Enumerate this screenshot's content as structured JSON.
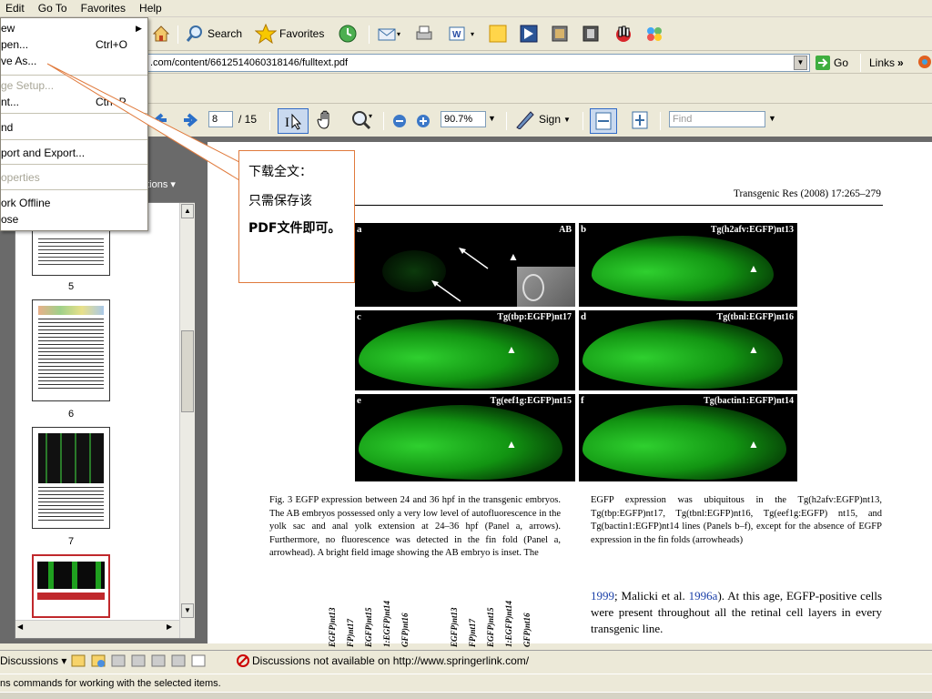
{
  "menubar": {
    "items": [
      "Edit",
      "Go To",
      "Favorites",
      "Help"
    ]
  },
  "ie_toolbar": {
    "search_label": "Search",
    "favorites_label": "Favorites"
  },
  "address": {
    "value": ".com/content/6612514060318146/fulltext.pdf",
    "go_label": "Go",
    "links_label": "Links",
    "more": "»"
  },
  "file_menu": {
    "items": [
      {
        "label": "ew",
        "shortcut": "",
        "disabled": false,
        "submenu": true
      },
      {
        "label": "pen...",
        "shortcut": "Ctrl+O",
        "disabled": false
      },
      {
        "label": "ve As...",
        "shortcut": "",
        "disabled": false
      },
      {
        "label": "ge Setup...",
        "shortcut": "",
        "disabled": true
      },
      {
        "label": "nt...",
        "shortcut": "Ctrl+P",
        "disabled": false
      },
      {
        "label": "nd",
        "shortcut": "",
        "disabled": false
      },
      {
        "label": "port and Export...",
        "shortcut": "",
        "disabled": false
      },
      {
        "label": "operties",
        "shortcut": "",
        "disabled": true
      },
      {
        "label": "ork Offline",
        "shortcut": "",
        "disabled": false
      },
      {
        "label": "ose",
        "shortcut": "",
        "disabled": false
      }
    ]
  },
  "pdf_toolbar": {
    "page_value": "8",
    "page_total": "/ 15",
    "zoom_value": "90.7%",
    "sign_label": "Sign",
    "find_placeholder": "Find"
  },
  "sidebar": {
    "options_label": "ptions",
    "thumb_numbers": [
      "5",
      "6",
      "7"
    ]
  },
  "callout": {
    "lines": [
      "下载全文：",
      "只需保存该",
      "PDF文件即可。"
    ]
  },
  "doc": {
    "header": "Transgenic Res (2008) 17:265–279",
    "panels": [
      {
        "letter": "a",
        "title": "AB"
      },
      {
        "letter": "b",
        "title": "Tg(h2afv:EGFP)nt13"
      },
      {
        "letter": "c",
        "title": "Tg(tbp:EGFP)nt17"
      },
      {
        "letter": "d",
        "title": "Tg(tbnl:EGFP)nt16"
      },
      {
        "letter": "e",
        "title": "Tg(eef1g:EGFP)nt15"
      },
      {
        "letter": "f",
        "title": "Tg(bactin1:EGFP)nt14"
      }
    ],
    "caption_left": "Fig. 3 EGFP expression between 24 and 36 hpf in the transgenic embryos. The AB embryos possessed only a very low level of autofluorescence in the yolk sac and anal yolk extension at 24–36 hpf (Panel a, arrows). Furthermore, no fluorescence was detected in the fin fold (Panel a, arrowhead). A bright field image showing the AB embryo is inset. The",
    "caption_right": "EGFP expression was ubiquitous in the Tg(h2afv:EGFP)nt13, Tg(tbp:EGFP)nt17, Tg(tbnl:EGFP)nt16, Tg(eef1g:EGFP) nt15, and Tg(bactin1:EGFP)nt14 lines (Panels b–f), except for the absence of EGFP expression in the fin folds (arrowheads)",
    "body_right_1": "1999",
    "body_right_2": "; Malicki et al. ",
    "body_right_3": "1996a",
    "body_right_4": "). At this age, EGFP-positive cells were present throughout all the retinal cell layers in every transgenic line.",
    "rotated_labels": [
      "EGFP)nt13",
      "FP)nt17",
      "EGFP)nt15",
      "1:EGFP)nt14",
      "GFP)nt16",
      "EGFP)nt13",
      "FP)nt17",
      "EGFP)nt15",
      "1:EGFP)nt14",
      "GFP)nt16"
    ]
  },
  "discussions": {
    "label": "Discussions",
    "message": "Discussions not available on http://www.springerlink.com/"
  },
  "status": {
    "text": "ns commands for working with the selected items."
  },
  "colors": {
    "accent_blue": "#316ac5",
    "callout_border": "#e07a3c",
    "egfp_green": "#1fbf1f"
  }
}
